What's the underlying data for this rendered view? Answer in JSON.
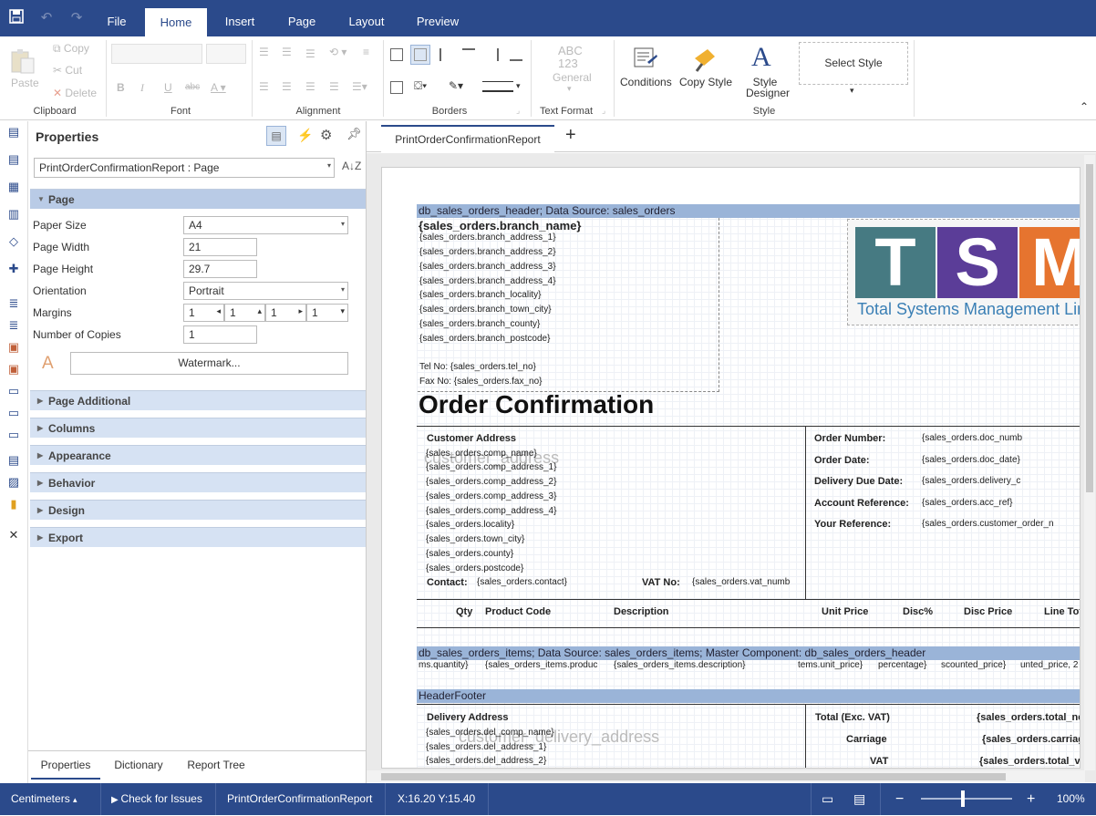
{
  "titlebar": {
    "menus": [
      "File",
      "Home",
      "Insert",
      "Page",
      "Layout",
      "Preview"
    ]
  },
  "ribbon": {
    "clipboard": {
      "paste": "Paste",
      "copy": "Copy",
      "cut": "Cut",
      "delete": "Delete",
      "label": "Clipboard"
    },
    "font": {
      "label": "Font"
    },
    "alignment": {
      "label": "Alignment"
    },
    "borders": {
      "label": "Borders"
    },
    "text_format": {
      "abc": "ABC",
      "num": "123",
      "general": "General",
      "label": "Text Format"
    },
    "style": {
      "conditions": "Conditions",
      "copy_style": "Copy Style",
      "style_designer": "Style Designer",
      "select_style": "Select Style",
      "label": "Style"
    }
  },
  "properties": {
    "title": "Properties",
    "selector": "PrintOrderConfirmationReport : Page",
    "page_section": "Page",
    "rows": {
      "paper_size": {
        "label": "Paper Size",
        "value": "A4"
      },
      "page_width": {
        "label": "Page Width",
        "value": "21"
      },
      "page_height": {
        "label": "Page Height",
        "value": "29.7"
      },
      "orientation": {
        "label": "Orientation",
        "value": "Portrait"
      },
      "margins": {
        "label": "Margins",
        "values": [
          "1",
          "1",
          "1",
          "1"
        ]
      },
      "copies": {
        "label": "Number of Copies",
        "value": "1"
      }
    },
    "watermark_button": "Watermark...",
    "sections": [
      "Page Additional",
      "Columns",
      "Appearance",
      "Behavior",
      "Design",
      "Export"
    ],
    "bottom_tabs": [
      "Properties",
      "Dictionary",
      "Report Tree"
    ]
  },
  "document_tab": "PrintOrderConfirmationReport",
  "report": {
    "header_band": "db_sales_orders_header; Data Source: sales_orders",
    "branch_name": "{sales_orders.branch_name}",
    "branch_lines": [
      "{sales_orders.branch_address_1}",
      "{sales_orders.branch_address_2}",
      "{sales_orders.branch_address_3}",
      "{sales_orders.branch_address_4}",
      "{sales_orders.branch_locality}",
      "{sales_orders.branch_town_city}",
      "{sales_orders.branch_county}",
      "{sales_orders.branch_postcode}"
    ],
    "tel": "Tel No: {sales_orders.tel_no}",
    "fax": "Fax No: {sales_orders.fax_no}",
    "logo_text": "TSM",
    "logo_sub": "Total Systems Management Limited",
    "title": "Order Confirmation",
    "customer_address_label": "Customer Address",
    "customer_watermark": "customer_address",
    "comp_lines": [
      "{sales_orders.comp_name}",
      "{sales_orders.comp_address_1}",
      "{sales_orders.comp_address_2}",
      "{sales_orders.comp_address_3}",
      "{sales_orders.comp_address_4}",
      "{sales_orders.locality}",
      "{sales_orders.town_city}",
      "{sales_orders.county}",
      "{sales_orders.postcode}"
    ],
    "contact_label": "Contact:",
    "contact_value": "{sales_orders.contact}",
    "vat_label": "VAT No:",
    "vat_value": "{sales_orders.vat_numb",
    "order_fields": [
      {
        "label": "Order Number:",
        "value": "{sales_orders.doc_numb"
      },
      {
        "label": "Order Date:",
        "value": "{sales_orders.doc_date}"
      },
      {
        "label": "Delivery Due Date:",
        "value": "{sales_orders.delivery_c"
      },
      {
        "label": "Account Reference:",
        "value": "{sales_orders.acc_ref}"
      },
      {
        "label": "Your Reference:",
        "value": "{sales_orders.customer_order_n"
      }
    ],
    "columns": [
      "Qty",
      "Product Code",
      "Description",
      "Unit Price",
      "Disc%",
      "Disc Price",
      "Line Tot"
    ],
    "items_band": "db_sales_orders_items; Data Source: sales_orders_items; Master Component: db_sales_orders_header",
    "items_fields": [
      "ms.quantity}",
      "{sales_orders_items.produc",
      "{sales_orders_items.description}",
      "tems.unit_price}",
      "percentage}",
      "scounted_price}",
      "unted_price, 2"
    ],
    "footer_band": "HeaderFooter",
    "delivery_label": "Delivery Address",
    "delivery_watermark": "customer_delivery_address",
    "del_lines": [
      "{sales_orders.del_comp_name}",
      "{sales_orders.del_address_1}",
      "{sales_orders.del_address_2}"
    ],
    "totals": [
      {
        "label": "Total (Exc. VAT)",
        "value": "{sales_orders.total_net"
      },
      {
        "label": "Carriage",
        "value": "{sales_orders.carriag"
      },
      {
        "label": "VAT",
        "value": "{sales_orders.total_va"
      }
    ]
  },
  "statusbar": {
    "units": "Centimeters",
    "check": "Check for Issues",
    "report": "PrintOrderConfirmationReport",
    "coords": "X:16.20 Y:15.40",
    "zoom": "100%"
  },
  "colors": {
    "accent": "#2b4a8b",
    "band": "#9ab4d8",
    "section": "#d6e2f3"
  }
}
